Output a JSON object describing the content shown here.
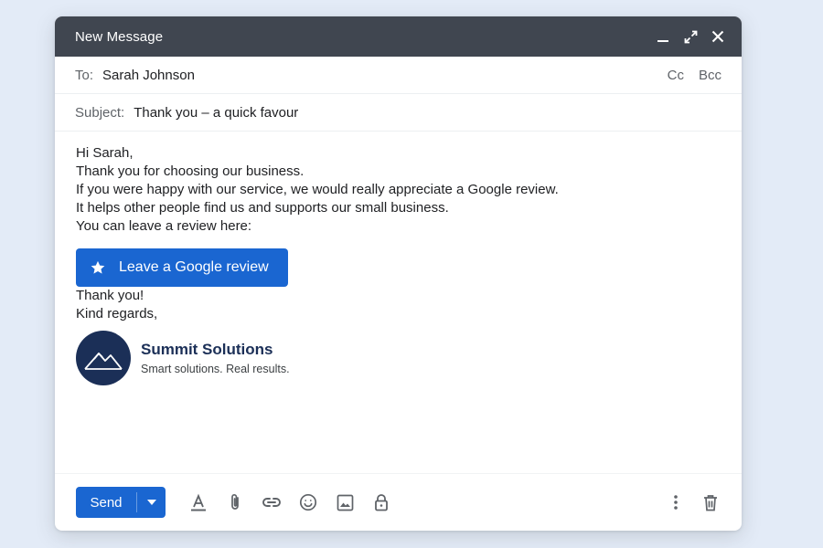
{
  "window": {
    "title": "New Message",
    "controls": [
      "minimize-icon",
      "expand-icon",
      "close-icon"
    ]
  },
  "recipients": {
    "to_label": "To:",
    "to_value": "Sarah Johnson",
    "cc_label": "Cc",
    "bcc_label": "Bcc"
  },
  "subject": {
    "label": "Subject:",
    "value": "Thank you – a quick favour"
  },
  "message": {
    "greeting": "Hi Sarah,",
    "thanks_line": "Thank you for choosing our business.",
    "review_line_1": "If you were happy with our service, we would really appreciate a Google review.",
    "review_line_2": "It helps other people find us and supports our small business.",
    "leave_review_line": "You can leave a review here:",
    "review_button_label": "Leave a Google review",
    "closing_1": "Thank you!",
    "closing_2": "Kind regards,"
  },
  "signature": {
    "company_name": "Summit Solutions",
    "tagline": "Smart solutions. Real results.",
    "logo_icon": "mountain-logo-icon"
  },
  "toolbar": {
    "send_label": "Send",
    "tools": [
      "text-format-icon",
      "attach-icon",
      "link-icon",
      "emoji-icon",
      "image-icon",
      "lock-icon"
    ],
    "right_tools": [
      "more-options-icon",
      "trash-icon"
    ]
  },
  "colors": {
    "accent": "#1a66d1",
    "titlebar": "#404650",
    "brand": "#1b2f57",
    "background": "#e3ebf7"
  }
}
